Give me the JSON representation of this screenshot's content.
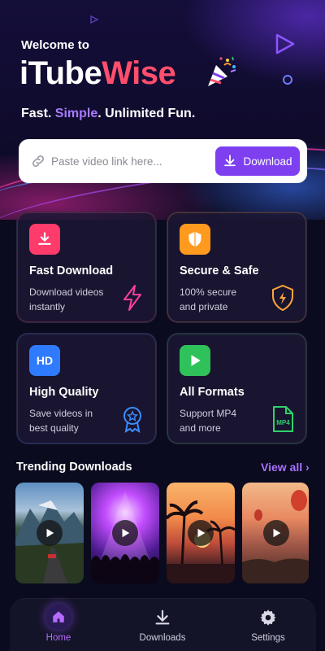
{
  "header": {
    "welcome": "Welcome to",
    "brand_part1": "iTube",
    "brand_part2": "Wise",
    "tagline_part1": "Fast.",
    "tagline_highlight": "Simple",
    "tagline_part2": ". Unlimited Fun."
  },
  "search": {
    "placeholder": "Paste video link here...",
    "button_label": "Download"
  },
  "features": [
    {
      "title": "Fast Download",
      "desc": "Download videos\ninstantly",
      "icon": "download-icon",
      "color": "#ff3b6b"
    },
    {
      "title": "Secure & Safe",
      "desc": "100% secure\nand private",
      "icon": "shield-icon",
      "color": "#ff9a1f"
    },
    {
      "title": "High Quality",
      "desc": "Save videos in\nbest quality",
      "icon": "hd-icon",
      "color": "#2f7bff"
    },
    {
      "title": "All Formats",
      "desc": "Support MP4\nand more",
      "icon": "play-icon",
      "color": "#2fc25a"
    }
  ],
  "mp4_label": "MP4",
  "hd_label": "HD",
  "trending": {
    "title": "Trending Downloads",
    "view_all": "View all"
  },
  "nav": {
    "home": "Home",
    "downloads": "Downloads",
    "settings": "Settings"
  },
  "colors": {
    "accent": "#7d3ff0",
    "brand_red": "#ff4f6d",
    "highlight": "#a97bff"
  }
}
